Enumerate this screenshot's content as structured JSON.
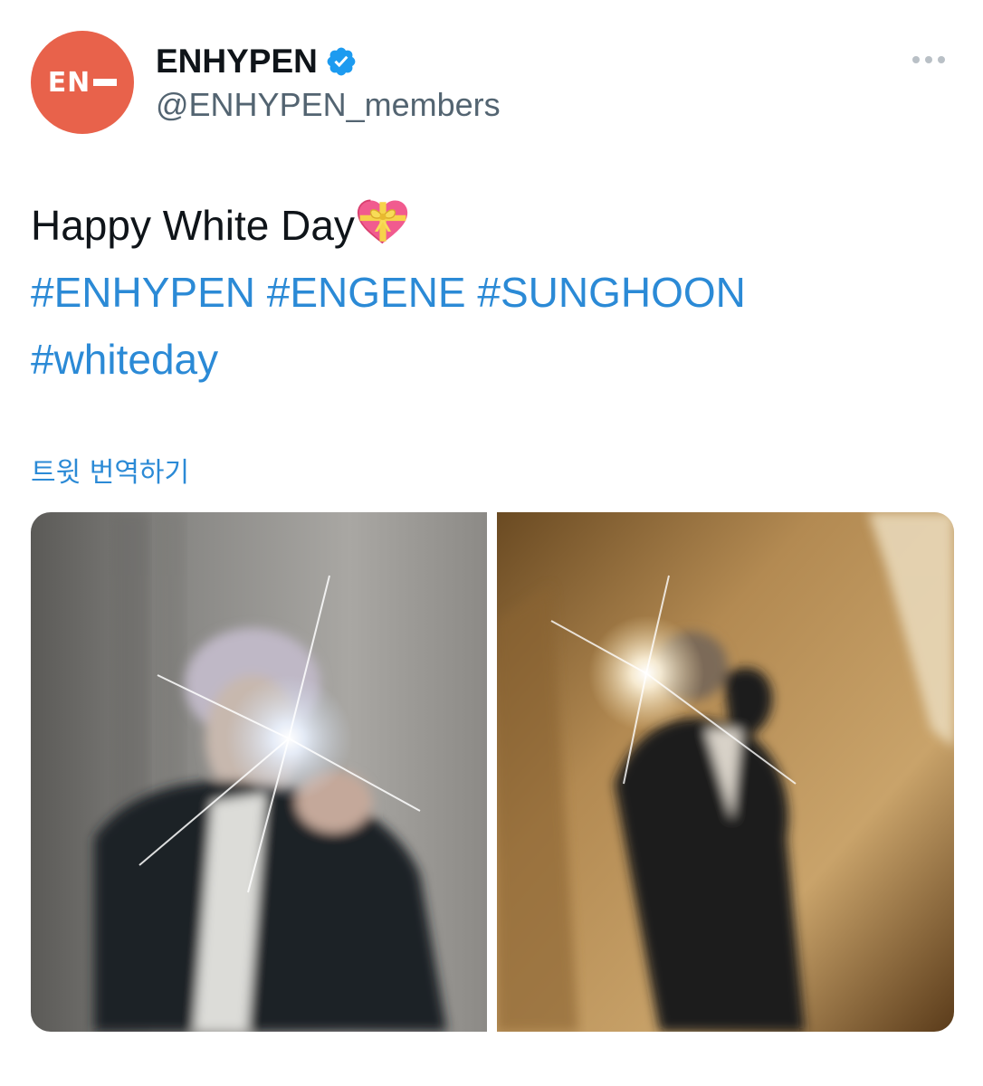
{
  "tweet": {
    "avatar_logo": "EN",
    "display_name": "ENHYPEN",
    "handle": "@ENHYPEN_members",
    "text_line1": "Happy White Day",
    "hashtags_line2": [
      "#ENHYPEN",
      "#ENGENE",
      "#SUNGHOON"
    ],
    "hashtags_line3": [
      "#whiteday"
    ],
    "translate_label": "트윗 번역하기"
  },
  "icons": {
    "verified": "verified-badge-icon",
    "more": "more-options-icon",
    "heart": "gift-heart-emoji"
  },
  "colors": {
    "accent": "#2b8ad6",
    "avatar_bg": "#e8624b",
    "verified": "#1d9bf0"
  }
}
